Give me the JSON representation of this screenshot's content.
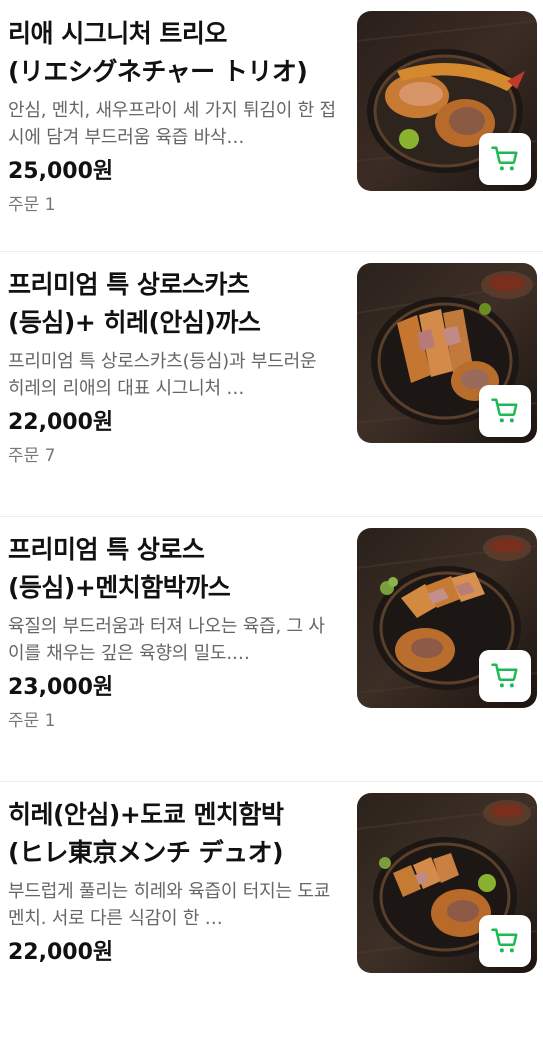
{
  "accent_color": "#2ac1bc",
  "cart_icon_color": "#1db954",
  "items": [
    {
      "title": "리애 시그니처 트리오(リエシグネチャー トリオ)",
      "description": "안심, 멘치, 새우프라이 세 가지 튀김이 한 접시에 담겨 부드러움 육즙 바삭…",
      "price": "25,000원",
      "orders": "주문 1",
      "image_icon": "food-photo-tonkatsu-trio"
    },
    {
      "title": "프리미엄 특 상로스카츠(등심)+ 히레(안심)까스",
      "description": "프리미엄 특 상로스카츠(등심)과 부드러운 히레의 리애의 대표 시그니처 …",
      "price": "22,000원",
      "orders": "주문 7",
      "image_icon": "food-photo-loin-fillet-katsu"
    },
    {
      "title": "프리미엄 특 상로스(등심)+멘치함박까스",
      "description": "육질의 부드러움과 터져 나오는 육즙, 그 사이를 채우는 깊은 육향의 밀도.…",
      "price": "23,000원",
      "orders": "주문 1",
      "image_icon": "food-photo-loin-menchi-katsu"
    },
    {
      "title": "히레(안심)+도쿄 멘치함박(ヒレ東京メンチ デュオ)",
      "description": "부드럽게 풀리는 히레와 육즙이 터지는 도쿄 멘치. 서로 다른 식감이 한 …",
      "price": "22,000원",
      "orders": "",
      "image_icon": "food-photo-fillet-menchi-duo"
    }
  ]
}
